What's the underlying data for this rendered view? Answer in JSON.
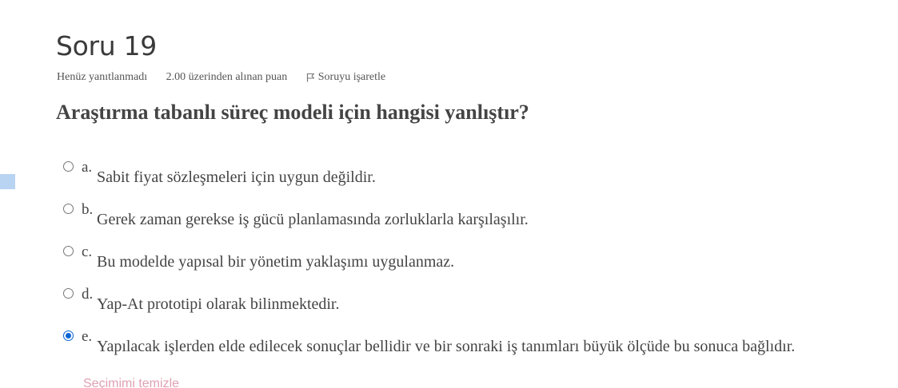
{
  "question": {
    "title": "Soru 19",
    "state": "Henüz yanıtlanmadı",
    "grade": "2.00 üzerinden alınan puan",
    "flag_label": "Soruyu işaretle",
    "flag_icon": "flag-icon",
    "text": "Araştırma tabanlı süreç modeli için hangisi yanlıştır?"
  },
  "answers": [
    {
      "letter": "a.",
      "text": "Sabit fiyat sözleşmeleri için uygun değildir.",
      "selected": false
    },
    {
      "letter": "b.",
      "text": "Gerek zaman gerekse iş gücü planlamasında zorluklarla karşılaşılır.",
      "selected": false
    },
    {
      "letter": "c.",
      "text": "Bu modelde yapısal bir yönetim yaklaşımı uygulanmaz.",
      "selected": false
    },
    {
      "letter": "d.",
      "text": "Yap-At prototipi olarak bilinmektedir.",
      "selected": false
    },
    {
      "letter": "e.",
      "text": "Yapılacak işlerden elde edilecek sonuçlar bellidir ve bir sonraki iş tanımları büyük ölçüde bu sonuca bağlıdır.",
      "selected": true
    }
  ],
  "clear_choice": "Seçimimi temizle",
  "colors": {
    "heading": "#3a3a3a",
    "text": "#444444",
    "radio_selected": "#0a66d6",
    "focus_highlight": "#b9d4f2",
    "clear_link": "#e0a1b3"
  }
}
